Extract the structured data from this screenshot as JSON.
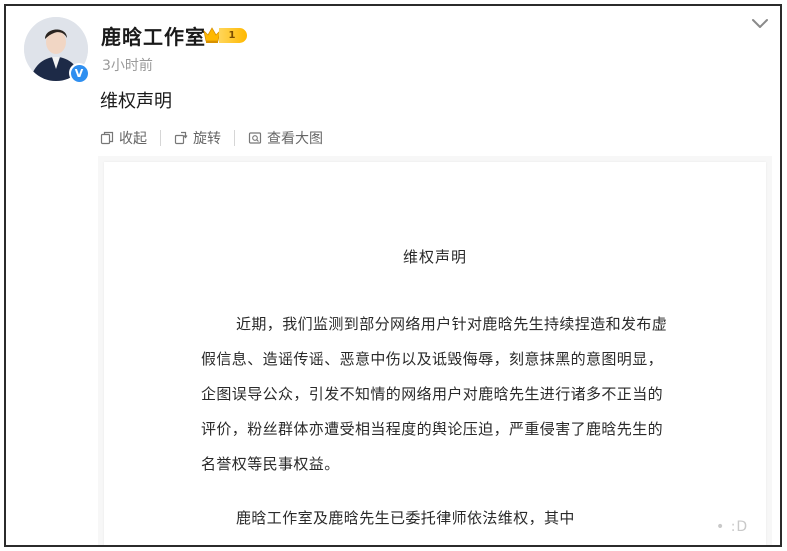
{
  "post": {
    "author": "鹿晗工作室",
    "vip_level": "1",
    "timestamp": "3小时前",
    "text": "维权声明"
  },
  "toolbar": {
    "collapse_label": "收起",
    "rotate_label": "旋转",
    "view_large_label": "查看大图"
  },
  "document": {
    "title": "维权声明",
    "lines": [
      "近期，我们监测到部分网络用户针对鹿晗先生持续捏造和发布虚",
      "假信息、造谣传谣、恶意中伤以及诋毁侮辱，刻意抹黑的意图明显，",
      "企图误导公众，引发不知情的网络用户对鹿晗先生进行诸多不正当的",
      "评价，粉丝群体亦遭受相当程度的舆论压迫，严重侵害了鹿晗先生的",
      "名誉权等民事权益。",
      "鹿晗工作室及鹿晗先生已委托律师依法维权，其中"
    ],
    "watermark": "• :D"
  },
  "colors": {
    "verified_blue": "#2f8ff0",
    "vip_gold": "#ffb800",
    "meta_gray": "#9a9a9a"
  },
  "icons": {
    "collapse": "collapse-icon",
    "rotate": "rotate-icon",
    "view_large": "view-large-icon",
    "chevron": "chevron-down-icon",
    "verified": "verified-icon",
    "crown": "crown-icon"
  }
}
